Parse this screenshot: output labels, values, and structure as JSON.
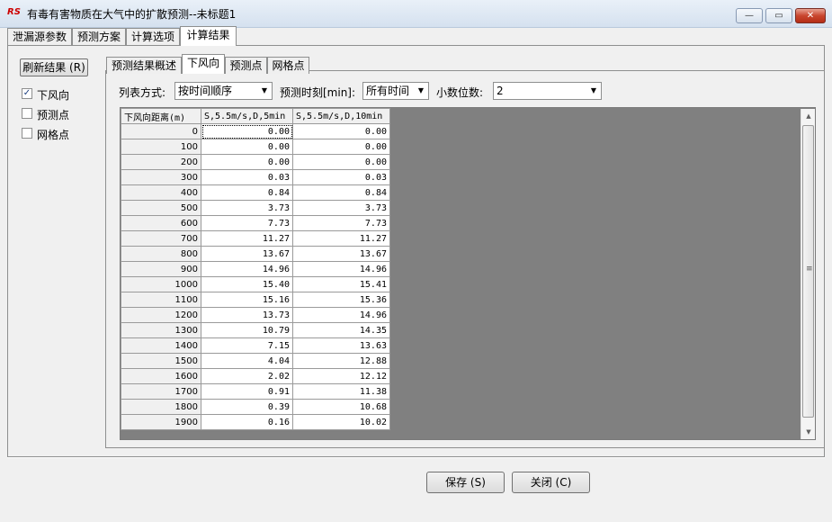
{
  "window": {
    "title": "有毒有害物质在大气中的扩散预测--未标题1",
    "app_icon": "RS",
    "controls": {
      "minimize": "—",
      "maximize": "▭",
      "close": "✕"
    }
  },
  "top_tabs": [
    {
      "label": "泄漏源参数"
    },
    {
      "label": "预测方案"
    },
    {
      "label": "计算选项"
    },
    {
      "label": "计算结果"
    }
  ],
  "sidebar": {
    "refresh_label": "刷新结果 (R)",
    "checkboxes": [
      {
        "label": "下风向",
        "checked": true
      },
      {
        "label": "预测点",
        "checked": false
      },
      {
        "label": "网格点",
        "checked": false
      }
    ]
  },
  "inner_tabs": [
    {
      "label": "预测结果概述"
    },
    {
      "label": "下风向"
    },
    {
      "label": "预测点"
    },
    {
      "label": "网格点"
    }
  ],
  "options": {
    "list_mode_label": "列表方式:",
    "list_mode_value": "按时间顺序",
    "time_label": "预测时刻[min]:",
    "time_value": "所有时间",
    "decimals_label": "小数位数:",
    "decimals_value": "2"
  },
  "table": {
    "headers": [
      "下风向距离(m)",
      "S,5.5m/s,D,5min",
      "S,5.5m/s,D,10min"
    ],
    "rows": [
      [
        "0",
        "0.00",
        "0.00"
      ],
      [
        "100",
        "0.00",
        "0.00"
      ],
      [
        "200",
        "0.00",
        "0.00"
      ],
      [
        "300",
        "0.03",
        "0.03"
      ],
      [
        "400",
        "0.84",
        "0.84"
      ],
      [
        "500",
        "3.73",
        "3.73"
      ],
      [
        "600",
        "7.73",
        "7.73"
      ],
      [
        "700",
        "11.27",
        "11.27"
      ],
      [
        "800",
        "13.67",
        "13.67"
      ],
      [
        "900",
        "14.96",
        "14.96"
      ],
      [
        "1000",
        "15.40",
        "15.41"
      ],
      [
        "1100",
        "15.16",
        "15.36"
      ],
      [
        "1200",
        "13.73",
        "14.96"
      ],
      [
        "1300",
        "10.79",
        "14.35"
      ],
      [
        "1400",
        "7.15",
        "13.63"
      ],
      [
        "1500",
        "4.04",
        "12.88"
      ],
      [
        "1600",
        "2.02",
        "12.12"
      ],
      [
        "1700",
        "0.91",
        "11.38"
      ],
      [
        "1800",
        "0.39",
        "10.68"
      ],
      [
        "1900",
        "0.16",
        "10.02"
      ]
    ]
  },
  "buttons": {
    "save": "保存 (S)",
    "close": "关闭 (C)"
  },
  "colors": {
    "grid_empty_area": "#808080",
    "titlebar": "#dbe6f4",
    "close_button": "#c9462f"
  }
}
